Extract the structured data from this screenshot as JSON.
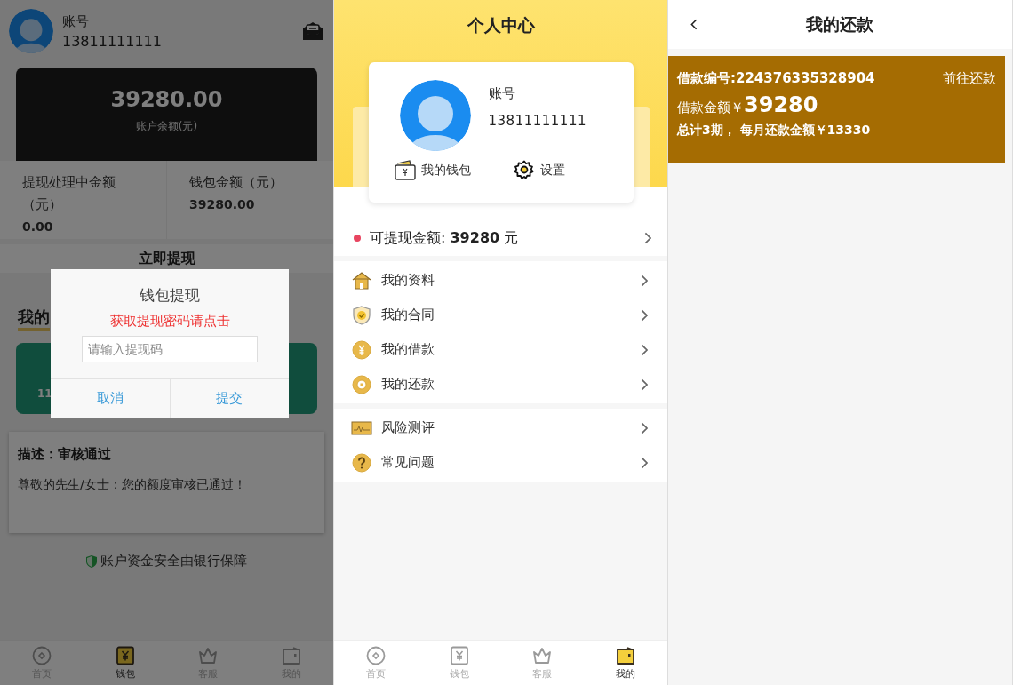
{
  "wallet_screen": {
    "account": {
      "label": "账号",
      "phone": "13811111111"
    },
    "balance": {
      "amount": "39280.00",
      "label": "账户余额(元)"
    },
    "stats": [
      {
        "label": "提现处理中金额（元）",
        "value": "0.00"
      },
      {
        "label": "钱包金额（元）",
        "value": "39280.00"
      }
    ],
    "withdraw_button": "立即提现",
    "section_title": "我的",
    "green_card_text": "11",
    "notice": {
      "title": "描述：审核通过",
      "body": "尊敬的先生/女士：您的额度审核已通过！"
    },
    "security_note": "账户资金安全由银行保障",
    "tabs": [
      {
        "label": "首页",
        "kind": "home",
        "selected": false
      },
      {
        "label": "钱包",
        "kind": "wallet",
        "selected": true
      },
      {
        "label": "客服",
        "kind": "service",
        "selected": false
      },
      {
        "label": "我的",
        "kind": "mine",
        "selected": false
      }
    ],
    "dialog": {
      "title": "钱包提现",
      "link": "获取提现密码请点击",
      "placeholder": "请输入提现码",
      "buttons": [
        "取消",
        "提交"
      ]
    }
  },
  "profile_screen": {
    "title": "个人中心",
    "account": {
      "label": "账号",
      "phone": "13811111111"
    },
    "shortcuts": [
      {
        "label": "我的钱包",
        "kind": "wallet"
      },
      {
        "label": "设置",
        "kind": "settings"
      }
    ],
    "withdrawable": {
      "label": "可提现金额: ",
      "amount": "39280",
      "unit": " 元"
    },
    "menu_groups": [
      [
        {
          "label": "我的资料",
          "kind": "house"
        },
        {
          "label": "我的合同",
          "kind": "shield"
        },
        {
          "label": "我的借款",
          "kind": "coin"
        },
        {
          "label": "我的还款",
          "kind": "ring"
        }
      ],
      [
        {
          "label": "风险测评",
          "kind": "chart"
        },
        {
          "label": "常见问题",
          "kind": "question"
        }
      ]
    ],
    "tabs": [
      {
        "label": "首页",
        "kind": "home",
        "selected": false
      },
      {
        "label": "钱包",
        "kind": "wallet",
        "selected": false
      },
      {
        "label": "客服",
        "kind": "service",
        "selected": false
      },
      {
        "label": "我的",
        "kind": "mine",
        "selected": true
      }
    ]
  },
  "repayment_screen": {
    "title": "我的还款",
    "loan": {
      "number": "借款编号:224376335328904",
      "action": "前往还款",
      "amount_label": "借款金额￥",
      "amount": "39280",
      "summary": "总计3期， 每月还款金额￥13330"
    }
  }
}
